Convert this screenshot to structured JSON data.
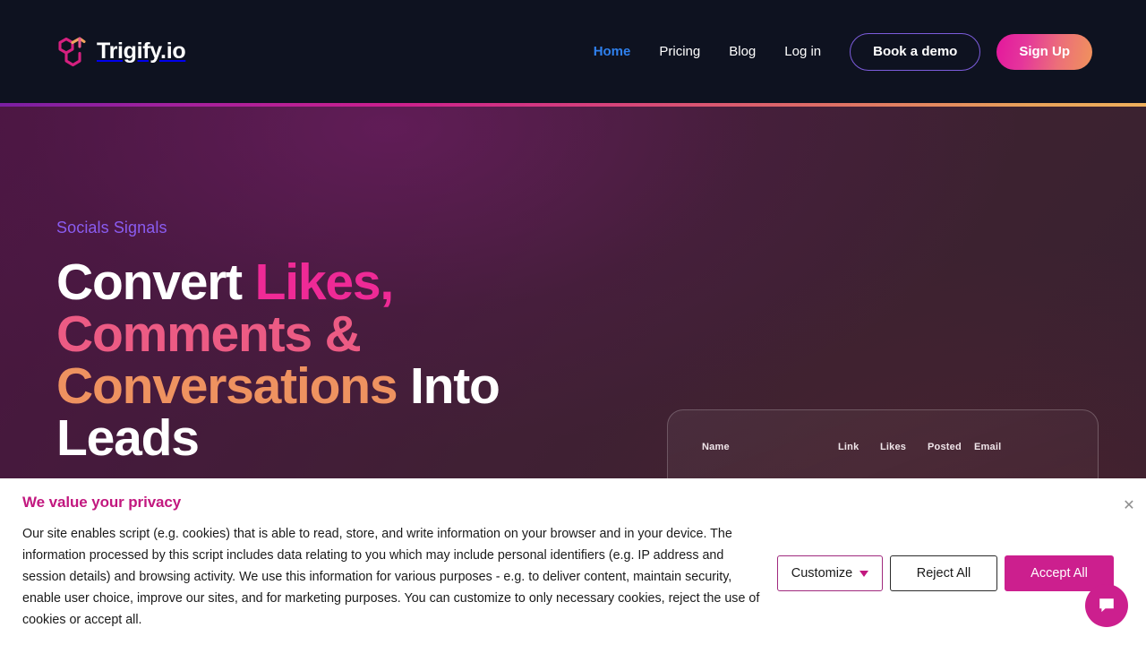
{
  "brand": {
    "name": "Trigify.io",
    "logo_icon": "trigify-cube-logo-icon",
    "logo_colors": [
      "#d6207f",
      "#e8568f",
      "#f0a45e"
    ]
  },
  "nav": {
    "links": [
      {
        "label": "Home",
        "active": true
      },
      {
        "label": "Pricing",
        "active": false
      },
      {
        "label": "Blog",
        "active": false
      },
      {
        "label": "Log in",
        "active": false
      }
    ],
    "demo_button": "Book a demo",
    "signup_button": "Sign Up",
    "active_color": "#2f80ed",
    "demo_border_color": "#7c5cdb",
    "signup_gradient_from": "#e3179d",
    "signup_gradient_to": "#f0935b",
    "bg_color": "#0e1220"
  },
  "accent_bar": {
    "from": "#7b1fa2",
    "mid": "#cc1f8e",
    "to": "#efb05c"
  },
  "hero": {
    "eyebrow": "Socials Signals",
    "eyebrow_color": "#8a5cf0",
    "headline_parts": [
      {
        "text": "Convert ",
        "color": "#ffffff"
      },
      {
        "text": "Likes,",
        "color": "#ef2a96"
      },
      {
        "text": "Comments &",
        "color": "#ec5b84"
      },
      {
        "text": "Conversations",
        "color": "#ee9260"
      },
      {
        "text": " Into",
        "color": "#ffffff"
      },
      {
        "text": "Leads",
        "color": "#ffffff"
      }
    ],
    "bg_color": "#451a3c"
  },
  "dashboard_preview": {
    "columns": [
      "Name",
      "Link",
      "Likes",
      "Posted",
      "Email"
    ]
  },
  "cookie_banner": {
    "title": "We value your privacy",
    "title_color": "#c2187f",
    "body": "Our site enables script (e.g. cookies) that is able to read, store, and write information on your browser and in your device. The information processed by this script includes data relating to you which may include personal identifiers (e.g. IP address and session details) and browsing activity. We use this information for various purposes - e.g. to deliver content, maintain security, enable user choice, improve our sites, and for marketing purposes. You can customize to only necessary cookies, reject the use of cookies or accept all.",
    "customize_label": "Customize",
    "reject_label": "Reject All",
    "accept_label": "Accept All",
    "close_label": "✕",
    "accept_bg": "#cc1f8e"
  },
  "chat_widget": {
    "icon": "chat-bubble-icon",
    "color": "#cc1f8e"
  }
}
